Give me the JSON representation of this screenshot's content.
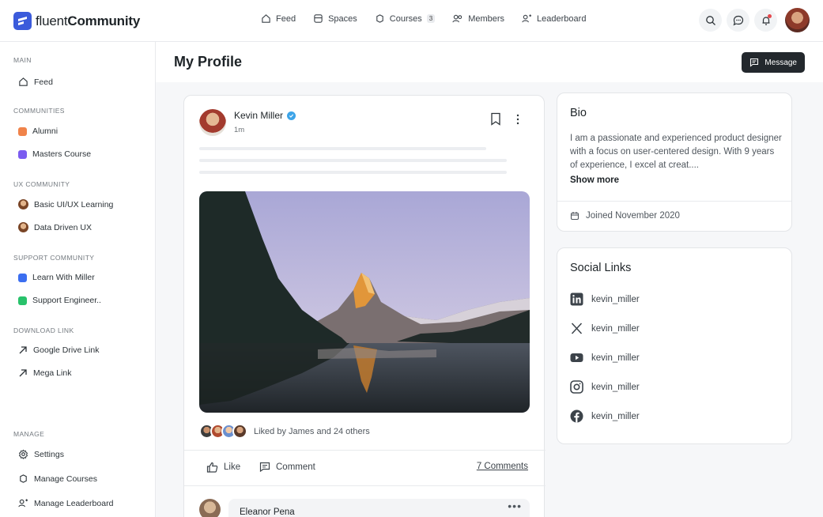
{
  "brand": {
    "prefix": "fluent",
    "suffix": "Community"
  },
  "nav": [
    {
      "label": "Feed"
    },
    {
      "label": "Spaces"
    },
    {
      "label": "Courses",
      "badge": "3"
    },
    {
      "label": "Members"
    },
    {
      "label": "Leaderboard"
    }
  ],
  "sidebar": {
    "main_title": "MAIN",
    "feed": "Feed",
    "communities_title": "COMMUNITIES",
    "communities": [
      "Alumni",
      "Masters Course"
    ],
    "ux_title": "UX COMMUNITY",
    "ux": [
      "Basic UI/UX Learning",
      "Data Driven UX"
    ],
    "support_title": "SUPPORT COMMUNITY",
    "support": [
      "Learn With Miller",
      "Support Engineer.."
    ],
    "download_title": "DOWNLOAD LINK",
    "download": [
      "Google Drive Link",
      "Mega Link"
    ],
    "manage_title": "MANAGE",
    "manage": [
      "Settings",
      "Manage Courses",
      "Manage Leaderboard"
    ]
  },
  "colors": {
    "alumni": "#f0834a",
    "masters": "#7b5cf0",
    "learn": "#3b6ef0",
    "support": "#28c26b",
    "accent": "#3b5bdb"
  },
  "page": {
    "title": "My Profile",
    "message_button": "Message"
  },
  "post": {
    "author": "Kevin Miller",
    "time": "1m",
    "liked_by": "Liked by James and 24 others",
    "like": "Like",
    "comment": "Comment",
    "comments_count": "7 Comments",
    "commenter": "Eleanor Pena",
    "comment_more": "•••"
  },
  "bio": {
    "title": "Bio",
    "text": "I am a passionate and experienced product designer with a focus on user-centered design. With 9 years of experience, I excel at creat....",
    "show_more": "Show more",
    "joined": "Joined November 2020"
  },
  "social": {
    "title": "Social Links",
    "links": [
      {
        "icon": "linkedin-icon",
        "handle": "kevin_miller"
      },
      {
        "icon": "x-icon",
        "handle": "kevin_miller"
      },
      {
        "icon": "youtube-icon",
        "handle": "kevin_miller"
      },
      {
        "icon": "instagram-icon",
        "handle": "kevin_miller"
      },
      {
        "icon": "facebook-icon",
        "handle": "kevin_miller"
      }
    ]
  }
}
